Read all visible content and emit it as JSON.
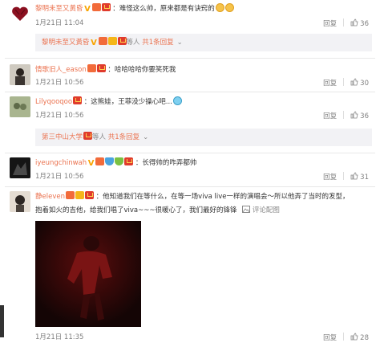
{
  "comments": [
    {
      "username": "黎明未至又黃昏",
      "text": "：难怪这么帅，原来都是有诀窍的",
      "time": "1月21日 11:04",
      "reply": "回复",
      "likes": "36",
      "sub": {
        "user": "黎明未至又黃昏",
        "suffix": "等人",
        "link": "共1条回复"
      }
    },
    {
      "username": "情歌旧人_eason",
      "text": "：哈哈哈哈你要笑死我",
      "time": "1月21日 10:56",
      "reply": "回复",
      "likes": "30"
    },
    {
      "username": "Lilyqooqoo",
      "text": "：这熊娃，王菲没少操心吧...",
      "time": "1月21日 10:56",
      "reply": "回复",
      "likes": "36",
      "sub": {
        "user": "第三中山大学",
        "suffix": "等人",
        "link": "共1条回复"
      }
    },
    {
      "username": "iyeungchinwah",
      "text": "：长得帅的咋弄都帅",
      "time": "1月21日 10:56",
      "reply": "回复",
      "likes": "31"
    },
    {
      "username": "静eleven",
      "text": "：他知道我们在等什么，在等一场viva live一样的演唱会～所以他弄了当时的发型，",
      "text2": "抱着如火的吉他，给我们唱了viva~~~很暖心了，我们最好的锋锋",
      "review": "评论配图",
      "time": "1月21日 11:35",
      "reply": "回复",
      "likes": "28"
    }
  ],
  "colors": {
    "username": "#eb7350",
    "meta": "#808080",
    "subbar_bg": "#f2f2f5"
  },
  "icons": [
    "heart-badge-icon",
    "weibo-vip-icon",
    "thumbs-up-icon",
    "emoji-icon",
    "picture-icon"
  ]
}
